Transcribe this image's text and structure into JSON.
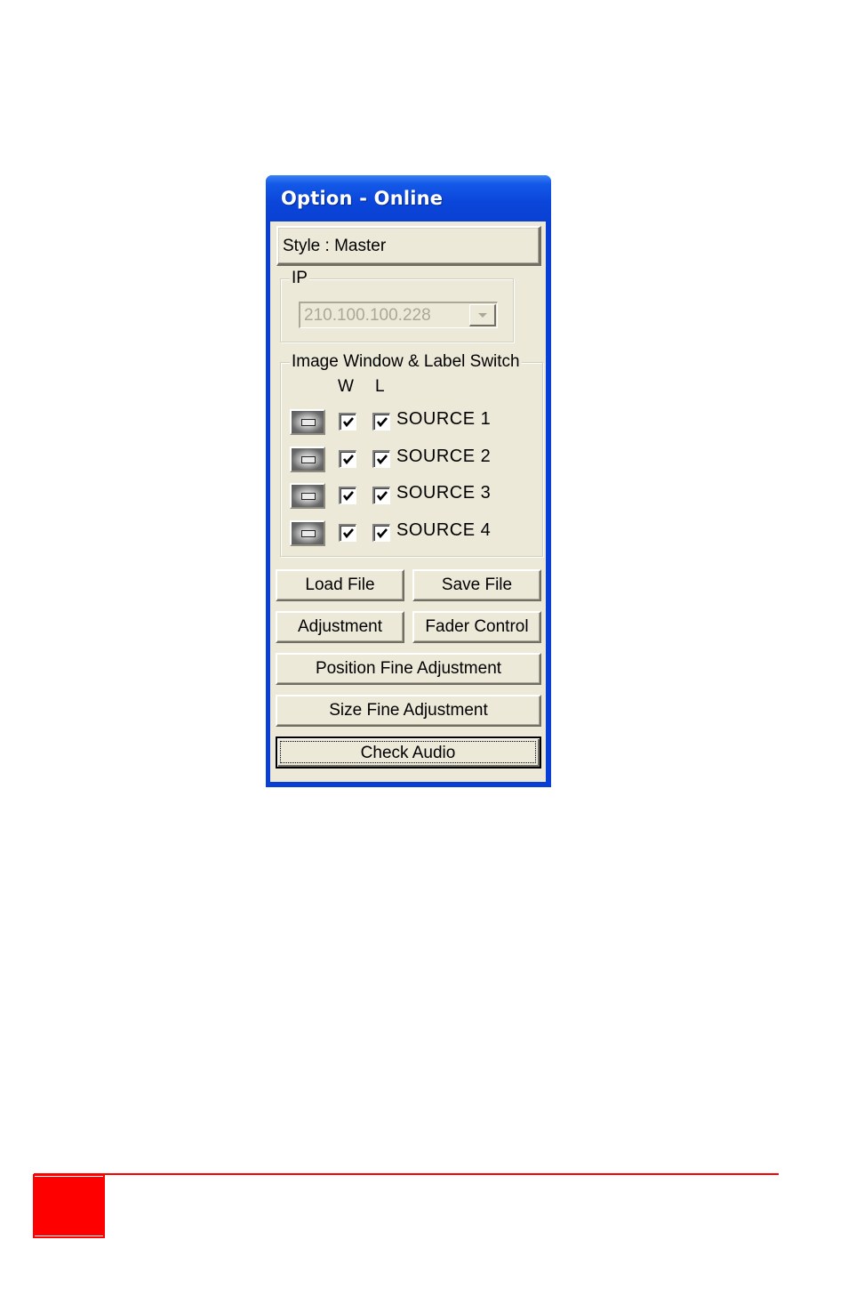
{
  "window": {
    "title": "Option - Online",
    "style_text": "Style : Master"
  },
  "ip_group": {
    "label": "IP",
    "value": "210.100.100.228",
    "disabled": true
  },
  "image_group": {
    "label": "Image Window & Label Switch",
    "col_w": "W",
    "col_l": "L",
    "sources": [
      {
        "label": "SOURCE 1",
        "w_checked": true,
        "l_checked": true
      },
      {
        "label": "SOURCE 2",
        "w_checked": true,
        "l_checked": true
      },
      {
        "label": "SOURCE 3",
        "w_checked": true,
        "l_checked": true
      },
      {
        "label": "SOURCE 4",
        "w_checked": true,
        "l_checked": true
      }
    ]
  },
  "buttons": {
    "load_file": "Load File",
    "save_file": "Save File",
    "adjustment": "Adjustment",
    "fader_control": "Fader Control",
    "position_fine": "Position Fine Adjustment",
    "size_fine": "Size Fine Adjustment",
    "check_audio": "Check Audio"
  },
  "colors": {
    "titlebar": "#0a3fd6",
    "dialog_bg": "#ece9d8",
    "footer_accent": "#ff0000"
  }
}
